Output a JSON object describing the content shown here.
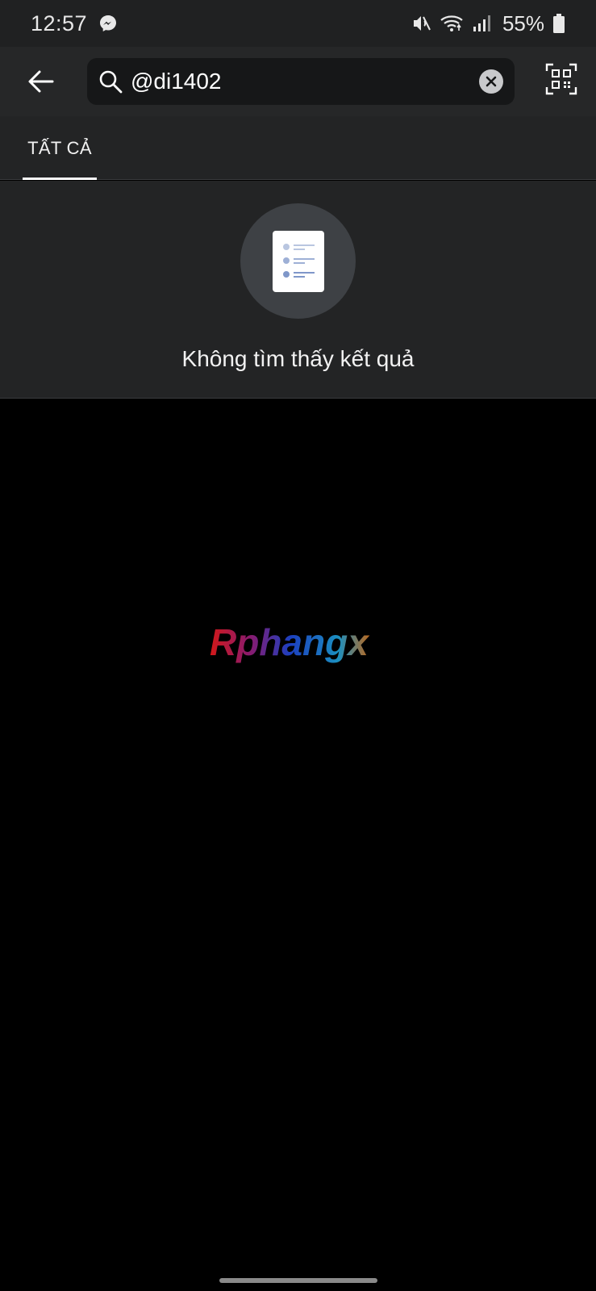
{
  "status_bar": {
    "time": "12:57",
    "battery_percent": "55%",
    "icons": [
      "messenger-icon",
      "mute-icon",
      "wifi-icon",
      "signal-icon",
      "battery-icon"
    ]
  },
  "search": {
    "query": "@di1402",
    "icons": [
      "back-arrow-icon",
      "search-icon",
      "clear-icon",
      "qr-scan-icon"
    ]
  },
  "tabs": [
    {
      "label": "TẤT CẢ",
      "active": true
    }
  ],
  "empty_state": {
    "message": "Không tìm thấy kết quả",
    "icon": "document-list-icon"
  },
  "watermark": {
    "text": "Rphangx"
  },
  "colors": {
    "status_bg": "#202122",
    "header_bg": "#262728",
    "panel_bg": "#232425",
    "search_bg": "#161718",
    "empty_circle": "#3e4145",
    "background": "#000000"
  }
}
